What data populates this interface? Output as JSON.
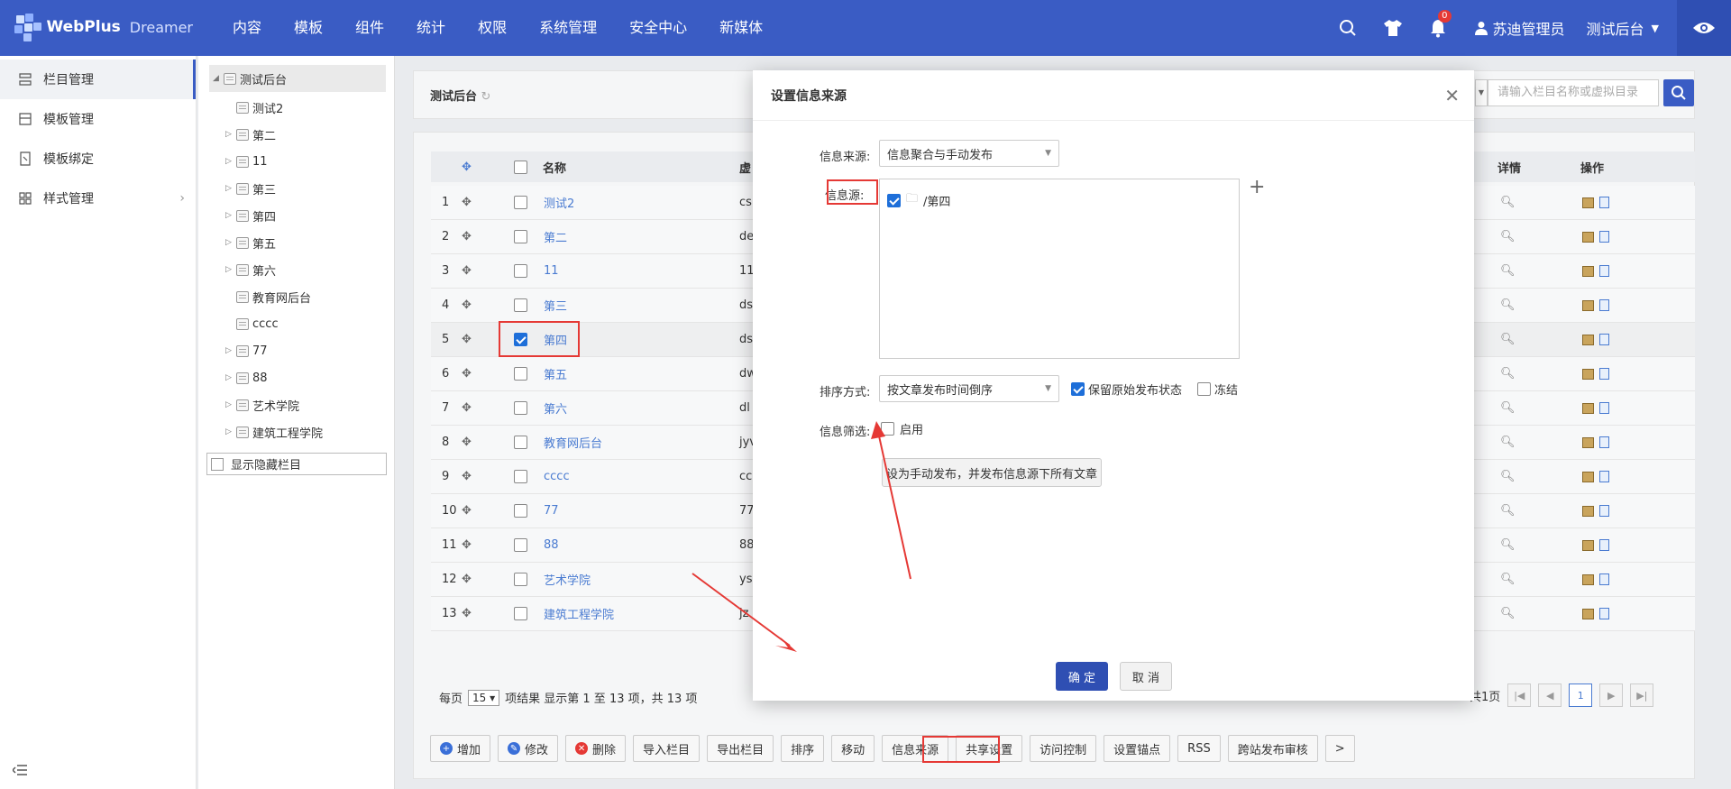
{
  "app": {
    "brand": "WebPlus",
    "product": "Dreamer"
  },
  "nav": [
    "内容",
    "模板",
    "组件",
    "统计",
    "权限",
    "系统管理",
    "安全中心",
    "新媒体"
  ],
  "header": {
    "notif_count": "0",
    "user": "苏迪管理员",
    "site": "测试后台"
  },
  "sidebar": [
    {
      "label": "栏目管理",
      "icon": "column-icon"
    },
    {
      "label": "模板管理",
      "icon": "template-icon"
    },
    {
      "label": "模板绑定",
      "icon": "bind-icon"
    },
    {
      "label": "样式管理",
      "icon": "style-icon"
    }
  ],
  "tree": {
    "root": "测试后台",
    "items": [
      {
        "label": "测试2",
        "exp": false
      },
      {
        "label": "第二",
        "exp": true
      },
      {
        "label": "11",
        "exp": true
      },
      {
        "label": "第三",
        "exp": true
      },
      {
        "label": "第四",
        "exp": true
      },
      {
        "label": "第五",
        "exp": true
      },
      {
        "label": "第六",
        "exp": true
      },
      {
        "label": "教育网后台",
        "exp": false
      },
      {
        "label": "cccc",
        "exp": false
      },
      {
        "label": "77",
        "exp": true
      },
      {
        "label": "88",
        "exp": true
      },
      {
        "label": "艺术学院",
        "exp": true
      },
      {
        "label": "建筑工程学院",
        "exp": true
      }
    ],
    "show_hidden": "显示隐藏栏目"
  },
  "breadcrumb": "测试后台",
  "search": {
    "placeholder": "请输入栏目名称或虚拟目录"
  },
  "table": {
    "headers": {
      "name": "名称",
      "virtual": "虚",
      "detail": "详情",
      "ops": "操作"
    },
    "rows": [
      {
        "n": "1",
        "name": "测试2",
        "v": "cs",
        "on": false
      },
      {
        "n": "2",
        "name": "第二",
        "v": "de",
        "on": false
      },
      {
        "n": "3",
        "name": "11",
        "v": "11",
        "on": false
      },
      {
        "n": "4",
        "name": "第三",
        "v": "ds",
        "on": false
      },
      {
        "n": "5",
        "name": "第四",
        "v": "ds",
        "on": true
      },
      {
        "n": "6",
        "name": "第五",
        "v": "dw",
        "on": false
      },
      {
        "n": "7",
        "name": "第六",
        "v": "dl",
        "on": false
      },
      {
        "n": "8",
        "name": "教育网后台",
        "v": "jyv",
        "on": false
      },
      {
        "n": "9",
        "name": "cccc",
        "v": "cc",
        "on": false
      },
      {
        "n": "10",
        "name": "77",
        "v": "77",
        "on": false
      },
      {
        "n": "11",
        "name": "88",
        "v": "88",
        "on": false
      },
      {
        "n": "12",
        "name": "艺术学院",
        "v": "ys",
        "on": false
      },
      {
        "n": "13",
        "name": "建筑工程学院",
        "v": "jz",
        "on": false
      }
    ]
  },
  "pager": {
    "per_page_label": "每页",
    "per_page": "15",
    "summary": "项结果 显示第 1 至 13 项，共 13 项",
    "total_pages": "共1页",
    "current": "1"
  },
  "toolbar": [
    {
      "label": "增加",
      "icon": "plus-icon",
      "color": "#3a6fd8"
    },
    {
      "label": "修改",
      "icon": "edit-icon",
      "color": "#3a6fd8"
    },
    {
      "label": "删除",
      "icon": "delete-icon",
      "color": "#e53935"
    },
    {
      "label": "导入栏目"
    },
    {
      "label": "导出栏目"
    },
    {
      "label": "排序"
    },
    {
      "label": "移动"
    },
    {
      "label": "信息来源"
    },
    {
      "label": "共享设置"
    },
    {
      "label": "访问控制"
    },
    {
      "label": "设置锚点"
    },
    {
      "label": "RSS"
    },
    {
      "label": "跨站发布审核"
    },
    {
      "label": ">"
    }
  ],
  "modal": {
    "title": "设置信息来源",
    "source_label": "信息来源:",
    "source_value": "信息聚合与手动发布",
    "sources_label": "信息源:",
    "source_item": "/第四",
    "sort_label": "排序方式:",
    "sort_value": "按文章发布时间倒序",
    "keep_state": "保留原始发布状态",
    "freeze": "冻结",
    "filter_label": "信息筛选:",
    "enable": "启用",
    "manual_btn": "设为手动发布，并发布信息源下所有文章",
    "ok": "确 定",
    "cancel": "取 消"
  }
}
